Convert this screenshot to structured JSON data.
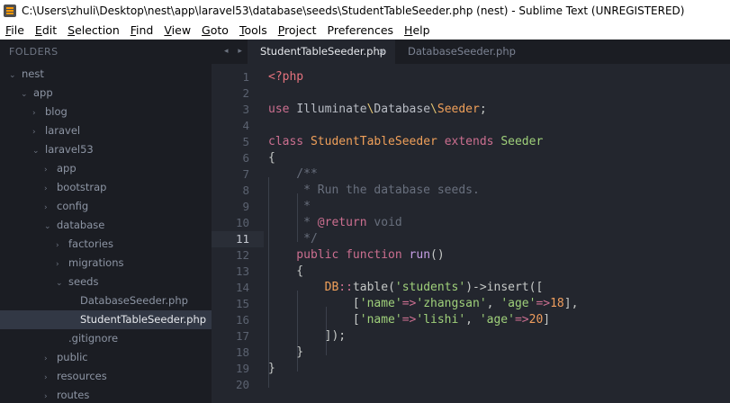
{
  "window": {
    "title": "C:\\Users\\zhuli\\Desktop\\nest\\app\\laravel53\\database\\seeds\\StudentTableSeeder.php (nest) - Sublime Text (UNREGISTERED)"
  },
  "menu": [
    {
      "u": "F",
      "rest": "ile"
    },
    {
      "u": "E",
      "rest": "dit"
    },
    {
      "u": "S",
      "rest": "election"
    },
    {
      "u": "F",
      "rest": "ind",
      "pre": ""
    },
    {
      "u": "V",
      "rest": "iew"
    },
    {
      "u": "G",
      "rest": "oto"
    },
    {
      "u": "T",
      "rest": "ools"
    },
    {
      "u": "P",
      "rest": "roject"
    },
    {
      "u": "",
      "rest": "Preferences"
    },
    {
      "u": "H",
      "rest": "elp"
    }
  ],
  "sidebar": {
    "header": "FOLDERS",
    "items": [
      {
        "label": "nest",
        "chev": "⌄",
        "depth": 0
      },
      {
        "label": "app",
        "chev": "⌄",
        "depth": 1
      },
      {
        "label": "blog",
        "chev": "›",
        "depth": 2
      },
      {
        "label": "laravel",
        "chev": "›",
        "depth": 2
      },
      {
        "label": "laravel53",
        "chev": "⌄",
        "depth": 2
      },
      {
        "label": "app",
        "chev": "›",
        "depth": 3
      },
      {
        "label": "bootstrap",
        "chev": "›",
        "depth": 3
      },
      {
        "label": "config",
        "chev": "›",
        "depth": 3
      },
      {
        "label": "database",
        "chev": "⌄",
        "depth": 3
      },
      {
        "label": "factories",
        "chev": "›",
        "depth": 4
      },
      {
        "label": "migrations",
        "chev": "›",
        "depth": 4
      },
      {
        "label": "seeds",
        "chev": "⌄",
        "depth": 4
      },
      {
        "label": "DatabaseSeeder.php",
        "chev": "",
        "depth": 5
      },
      {
        "label": "StudentTableSeeder.php",
        "chev": "",
        "depth": 5,
        "selected": true
      },
      {
        "label": ".gitignore",
        "chev": "",
        "depth": 4
      },
      {
        "label": "public",
        "chev": "›",
        "depth": 3
      },
      {
        "label": "resources",
        "chev": "›",
        "depth": 3
      },
      {
        "label": "routes",
        "chev": "›",
        "depth": 3
      }
    ]
  },
  "tabs": {
    "nav": "◂ ▸",
    "active": "StudentTableSeeder.php",
    "close": "×",
    "inactive": "DatabaseSeeder.php"
  },
  "editor": {
    "current_line": 11,
    "lines": [
      [
        {
          "t": "<?php",
          "c": "k-tag"
        }
      ],
      [],
      [
        {
          "t": "use ",
          "c": "k-kw"
        },
        {
          "t": "Illuminate",
          "c": "k-ns"
        },
        {
          "t": "\\",
          "c": "k-sep"
        },
        {
          "t": "Database",
          "c": "k-ns"
        },
        {
          "t": "\\",
          "c": "k-sep"
        },
        {
          "t": "Seeder",
          "c": "k-cls"
        },
        {
          "t": ";",
          "c": "k-punc"
        }
      ],
      [],
      [
        {
          "t": "class ",
          "c": "k-kw"
        },
        {
          "t": "StudentTableSeeder ",
          "c": "k-cls"
        },
        {
          "t": "extends ",
          "c": "k-kw"
        },
        {
          "t": "Seeder",
          "c": "k-str"
        }
      ],
      [
        {
          "t": "{",
          "c": "k-punc"
        }
      ],
      [
        {
          "t": "    /**",
          "c": "k-com"
        }
      ],
      [
        {
          "t": "     * Run the database seeds.",
          "c": "k-com"
        }
      ],
      [
        {
          "t": "     *",
          "c": "k-com"
        }
      ],
      [
        {
          "t": "     * ",
          "c": "k-com"
        },
        {
          "t": "@return",
          "c": "k-at"
        },
        {
          "t": " void",
          "c": "k-com"
        }
      ],
      [
        {
          "t": "     */",
          "c": "k-com"
        }
      ],
      [
        {
          "t": "    public ",
          "c": "k-kw"
        },
        {
          "t": "function ",
          "c": "k-kw"
        },
        {
          "t": "run",
          "c": "k-fn"
        },
        {
          "t": "()",
          "c": "k-punc"
        }
      ],
      [
        {
          "t": "    {",
          "c": "k-punc"
        }
      ],
      [
        {
          "t": "        DB",
          "c": "k-cls"
        },
        {
          "t": "::",
          "c": "k-kw"
        },
        {
          "t": "table(",
          "c": "k-punc"
        },
        {
          "t": "'students'",
          "c": "k-str"
        },
        {
          "t": ")->",
          "c": "k-punc"
        },
        {
          "t": "insert",
          "c": "k-punc"
        },
        {
          "t": "([",
          "c": "k-punc"
        }
      ],
      [
        {
          "t": "            [",
          "c": "k-punc"
        },
        {
          "t": "'name'",
          "c": "k-str"
        },
        {
          "t": "=>",
          "c": "k-kw"
        },
        {
          "t": "'zhangsan'",
          "c": "k-str"
        },
        {
          "t": ", ",
          "c": "k-punc"
        },
        {
          "t": "'age'",
          "c": "k-str"
        },
        {
          "t": "=>",
          "c": "k-kw"
        },
        {
          "t": "18",
          "c": "k-num"
        },
        {
          "t": "],",
          "c": "k-punc"
        }
      ],
      [
        {
          "t": "            [",
          "c": "k-punc"
        },
        {
          "t": "'name'",
          "c": "k-str"
        },
        {
          "t": "=>",
          "c": "k-kw"
        },
        {
          "t": "'lishi'",
          "c": "k-str"
        },
        {
          "t": ", ",
          "c": "k-punc"
        },
        {
          "t": "'age'",
          "c": "k-str"
        },
        {
          "t": "=>",
          "c": "k-kw"
        },
        {
          "t": "20",
          "c": "k-num"
        },
        {
          "t": "]",
          "c": "k-punc"
        }
      ],
      [
        {
          "t": "        ]);",
          "c": "k-punc"
        }
      ],
      [
        {
          "t": "    }",
          "c": "k-punc"
        }
      ],
      [
        {
          "t": "}",
          "c": "k-punc"
        }
      ],
      []
    ]
  }
}
